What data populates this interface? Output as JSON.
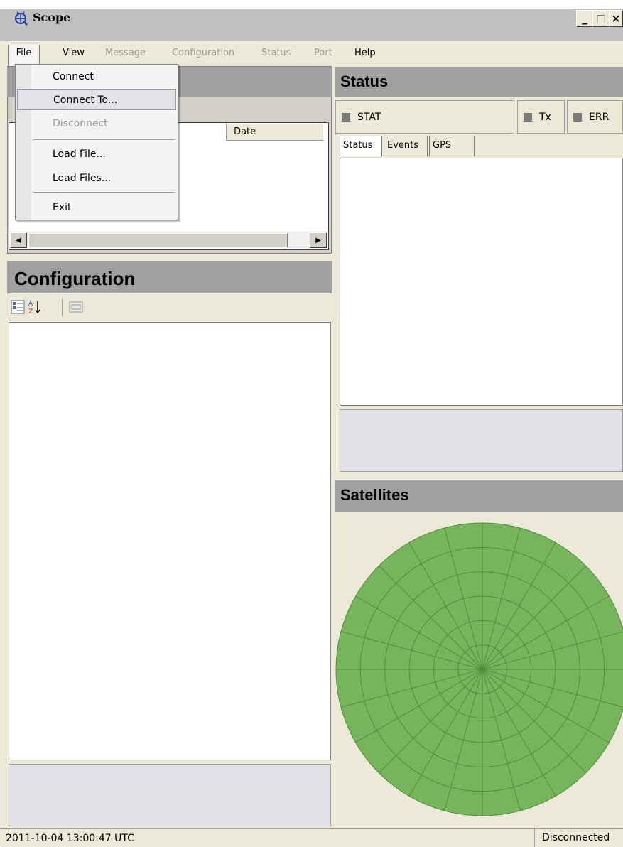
{
  "window": {
    "title": "Scope",
    "controls": {
      "minimize": "_",
      "maximize": "□",
      "close": "×"
    }
  },
  "menubar": {
    "items": [
      {
        "label": "File",
        "enabled": true
      },
      {
        "label": "View",
        "enabled": true
      },
      {
        "label": "Message",
        "enabled": false
      },
      {
        "label": "Configuration",
        "enabled": false
      },
      {
        "label": "Status",
        "enabled": false
      },
      {
        "label": "Port",
        "enabled": false
      },
      {
        "label": "Help",
        "enabled": true
      }
    ]
  },
  "file_menu": {
    "items": [
      {
        "label": "Connect",
        "enabled": true
      },
      {
        "label": "Connect To...",
        "enabled": true,
        "highlighted": true
      },
      {
        "label": "Disconnect",
        "enabled": false
      },
      {
        "label": "Load File...",
        "enabled": true
      },
      {
        "label": "Load Files...",
        "enabled": true
      },
      {
        "label": "Exit",
        "enabled": true
      }
    ]
  },
  "messages_panel": {
    "column_date": "Date"
  },
  "configuration": {
    "title": "Configuration",
    "toolbar": [
      "categorized-icon",
      "alphabetical-sort-icon",
      "property-pages-icon"
    ]
  },
  "status": {
    "title": "Status",
    "indicators": [
      {
        "label": "STAT",
        "color": "#7a7a7a"
      },
      {
        "label": "Tx",
        "color": "#7a7a7a"
      },
      {
        "label": "ERR",
        "color": "#7a7a7a"
      }
    ],
    "tabs": [
      "Status",
      "Events",
      "GPS"
    ],
    "active_tab": "Status"
  },
  "satellites": {
    "title": "Satellites",
    "plot_color": "#78b45e",
    "grid_color": "#4f8f3a"
  },
  "statusbar": {
    "timestamp": "2011-10-04 13:00:47 UTC",
    "connection": "Disconnected"
  }
}
